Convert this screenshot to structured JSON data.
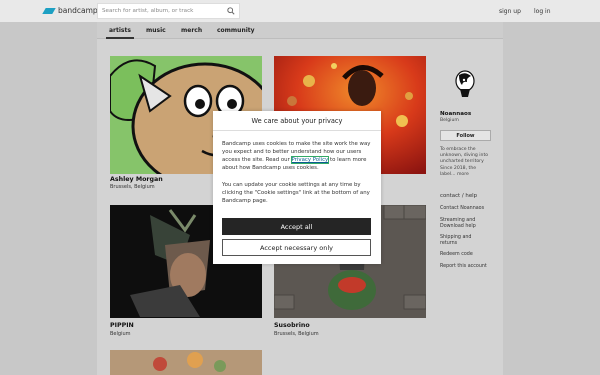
{
  "header": {
    "logo_text": "bandcamp",
    "search": {
      "placeholder": "Search for artist, album, or track"
    },
    "sign_up": "sign up",
    "log_in": "log in"
  },
  "nav": {
    "tabs": [
      {
        "label": "artists",
        "active": true
      },
      {
        "label": "music"
      },
      {
        "label": "merch"
      },
      {
        "label": "community"
      }
    ]
  },
  "artists": [
    {
      "name": "Ashley Morgan",
      "location": "Brussels, Belgium"
    },
    {
      "name": "",
      "location": ""
    },
    {
      "name": "PIPPIN",
      "location": "Belgium"
    },
    {
      "name": "Susobrino",
      "location": "Brussels, Belgium"
    }
  ],
  "sidebar": {
    "label_name": "Noannaos",
    "location": "Belgium",
    "follow_label": "Follow",
    "bio": "To embrace the unknown, diving into uncharted territory Since 2018, the label... more",
    "contact_heading": "contact / help",
    "links": [
      "Contact Noannaos",
      "Streaming and Download help",
      "Shipping and returns",
      "Redeem code",
      "Report this account"
    ]
  },
  "modal": {
    "title": "We care about your privacy",
    "p1_before": "Bandcamp uses cookies to make the site work the way you expect and to better understand how our users access the site. Read our ",
    "p1_link": "Privacy Policy",
    "p1_after": " to learn more about how Bandcamp uses cookies.",
    "p2": "You can update your cookie settings at any time by clicking the \"Cookie settings\" link at the bottom of any Bandcamp page.",
    "accept_all": "Accept all",
    "accept_necessary": "Accept necessary only"
  },
  "colors": {
    "brand": "#1da0c3",
    "accept_bg": "#252525"
  }
}
